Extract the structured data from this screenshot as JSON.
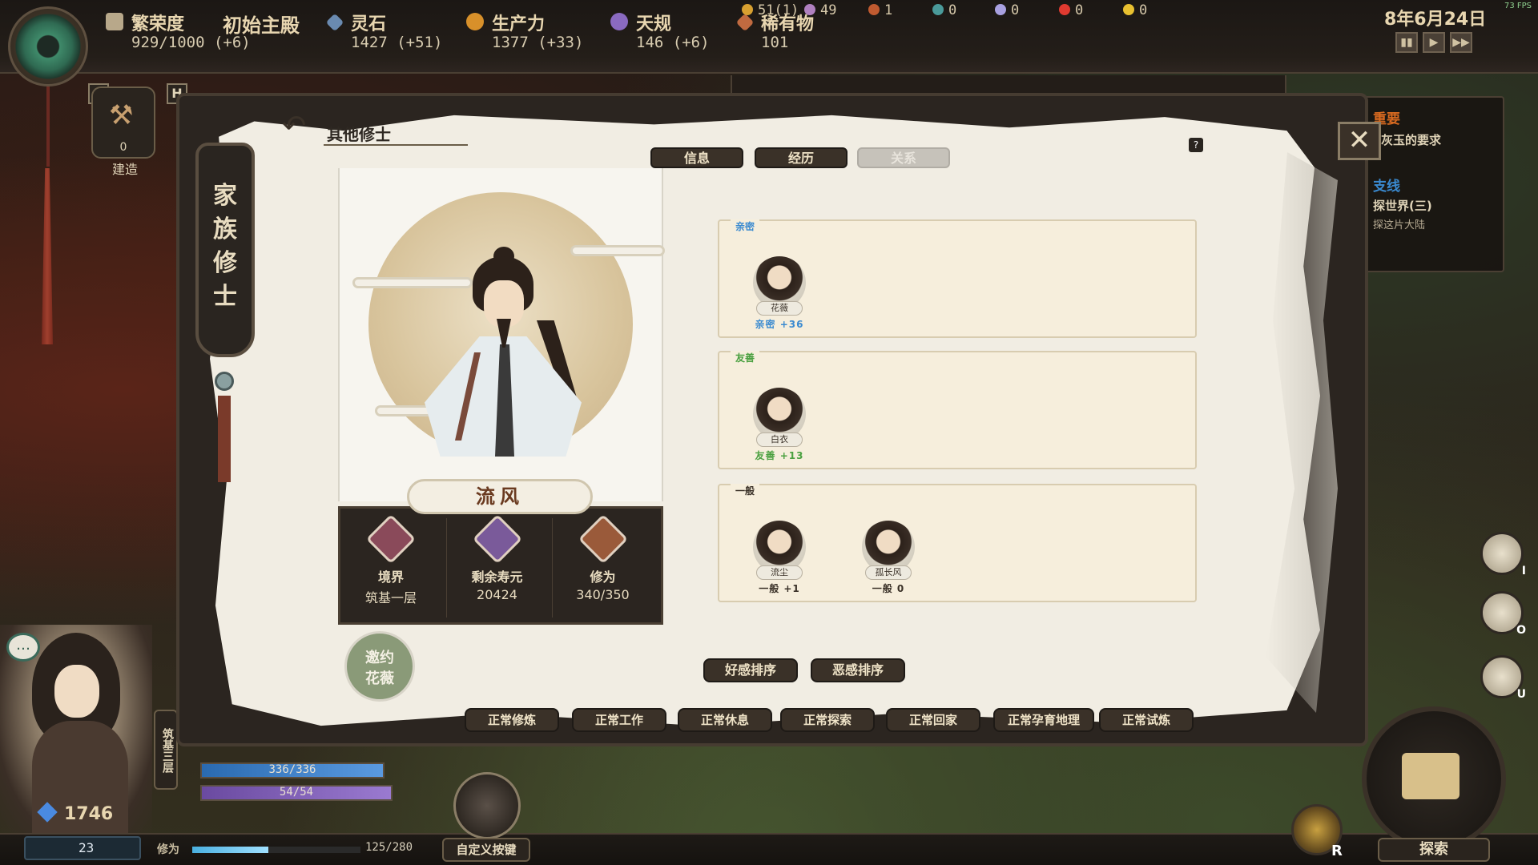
{
  "hud": {
    "prosperity": {
      "name": "繁荣度",
      "value": "929/1000 (+6)"
    },
    "main_hall": "初始主殿",
    "spirit_stone": {
      "name": "灵石",
      "value": "1427 (+51)"
    },
    "productivity": {
      "name": "生产力",
      "value": "1377 (+33)"
    },
    "heaven_rule": {
      "name": "天规",
      "value": "146 (+6)"
    },
    "rare_items": {
      "name": "稀有物",
      "value": "101"
    },
    "date": "8年6月24日",
    "fps": "73 FPS",
    "resources": [
      "51(1)",
      "49",
      "1",
      "0",
      "0",
      "0",
      "0"
    ],
    "hotkeys": {
      "b": "B",
      "h": "H"
    },
    "build": {
      "count": "0",
      "label": "建造"
    },
    "colors": {
      "accent": "#3a3128",
      "paper": "#f1ede3",
      "intimate": "#3a8ad0",
      "friendly": "#4aa040"
    }
  },
  "quests": {
    "important_head": "重要",
    "important_line": "灰玉的要求",
    "branch_head": "支线",
    "branch_line1": "探世界(三)",
    "branch_line2": "探这片大陆"
  },
  "side_keys": {
    "i": "I",
    "o": "O",
    "u": "U"
  },
  "dialog": {
    "back_title": "其他修士",
    "family_tab": "家族修士",
    "question": "?",
    "close": "✕",
    "tabs": {
      "info": "信息",
      "history": "经历",
      "relations": "关系"
    },
    "character": {
      "name": "流风",
      "stats": [
        {
          "label": "境界",
          "value": "筑基一层"
        },
        {
          "label": "剩余寿元",
          "value": "20424"
        },
        {
          "label": "修为",
          "value": "340/350"
        }
      ]
    },
    "invite": {
      "line1": "邀约",
      "line2": "花薇"
    },
    "groups": [
      {
        "label": "亲密",
        "people": [
          {
            "name": "花薇",
            "score": "亲密 +36"
          }
        ]
      },
      {
        "label": "友善",
        "people": [
          {
            "name": "白衣",
            "score": "友善 +13"
          }
        ]
      },
      {
        "label": "一般",
        "people": [
          {
            "name": "流尘",
            "score": "一般 +1"
          },
          {
            "name": "孤长风",
            "score": "一般 0"
          }
        ]
      }
    ],
    "sort": {
      "favor": "好感排序",
      "dislike": "恶感排序"
    },
    "modes": [
      "正常修炼",
      "正常工作",
      "正常休息",
      "正常探索",
      "正常回家",
      "正常孕育地理",
      "正常试炼"
    ]
  },
  "player": {
    "gems": "1746",
    "realm": "筑基三层",
    "hp": "336/336",
    "hp_fraction": 1.0,
    "mp": "54/54",
    "mp_fraction": 1.0,
    "level": "23",
    "cultivation_label": "修为",
    "cultivation": "125/280",
    "cultivation_fraction": 0.45,
    "custom_keybinds": "自定义按键",
    "explore": "探索",
    "r_key": "R",
    "chat": "…"
  }
}
